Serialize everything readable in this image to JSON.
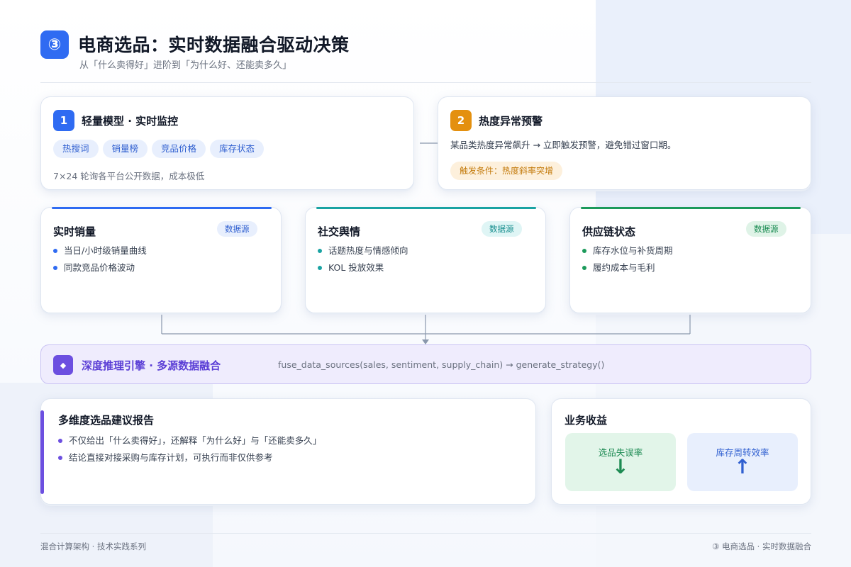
{
  "header": {
    "badge": "③",
    "title": "电商选品：实时数据融合驱动决策",
    "subtitle": "从「什么卖得好」进阶到「为什么好、还能卖多久」"
  },
  "monitor_card": {
    "number": "1",
    "title": "轻量模型 · 实时监控",
    "tags": [
      "热搜词",
      "销量榜",
      "竞品价格",
      "库存状态"
    ],
    "note": "7×24 轮询各平台公开数据，成本极低"
  },
  "alert_card": {
    "number": "2",
    "title": "热度异常预警",
    "description": "某品类热度异常飙升 → 立即触发预警，避免错过窗口期。",
    "trigger": "触发条件：热度斜率突增"
  },
  "sources": [
    {
      "title": "实时销量",
      "tag": "数据源",
      "items": [
        "当日/小时级销量曲线",
        "同款竞品价格波动"
      ],
      "color": "#2f6bf2",
      "tag_bg": "#e8effd",
      "tag_fg": "#2f5fd0"
    },
    {
      "title": "社交舆情",
      "tag": "数据源",
      "items": [
        "话题热度与情感倾向",
        "KOL 投放效果"
      ],
      "color": "#1aa3a3",
      "tag_bg": "#dff5f5",
      "tag_fg": "#158d8d"
    },
    {
      "title": "供应链状态",
      "tag": "数据源",
      "items": [
        "库存水位与补货周期",
        "履约成本与毛利"
      ],
      "color": "#1c9a5b",
      "tag_bg": "#dff3e7",
      "tag_fg": "#178a50"
    }
  ],
  "engine": {
    "icon": "◆",
    "title": "深度推理引擎 · 多源数据融合",
    "code": "fuse_data_sources(sales, sentiment, supply_chain) → generate_strategy()"
  },
  "report": {
    "title": "多维度选品建议报告",
    "items": [
      "不仅给出「什么卖得好」，还解释「为什么好」与「还能卖多久」",
      "结论直接对接采购与库存计划，可执行而非仅供参考"
    ]
  },
  "benefits": {
    "title": "业务收益",
    "items": [
      {
        "label": "选品失误率",
        "arrow": "↓",
        "bg": "#e2f5e9",
        "fg": "#1c8a52"
      },
      {
        "label": "库存周转效率",
        "arrow": "↑",
        "bg": "#e8effd",
        "fg": "#2f5fd0"
      }
    ]
  },
  "footer": {
    "left": "混合计算架构 · 技术实践系列",
    "right": "③ 电商选品 · 实时数据融合"
  },
  "colors": {
    "primary": "#2f6bf2",
    "orange": "#e4900f",
    "purple": "#6c4fe0"
  }
}
